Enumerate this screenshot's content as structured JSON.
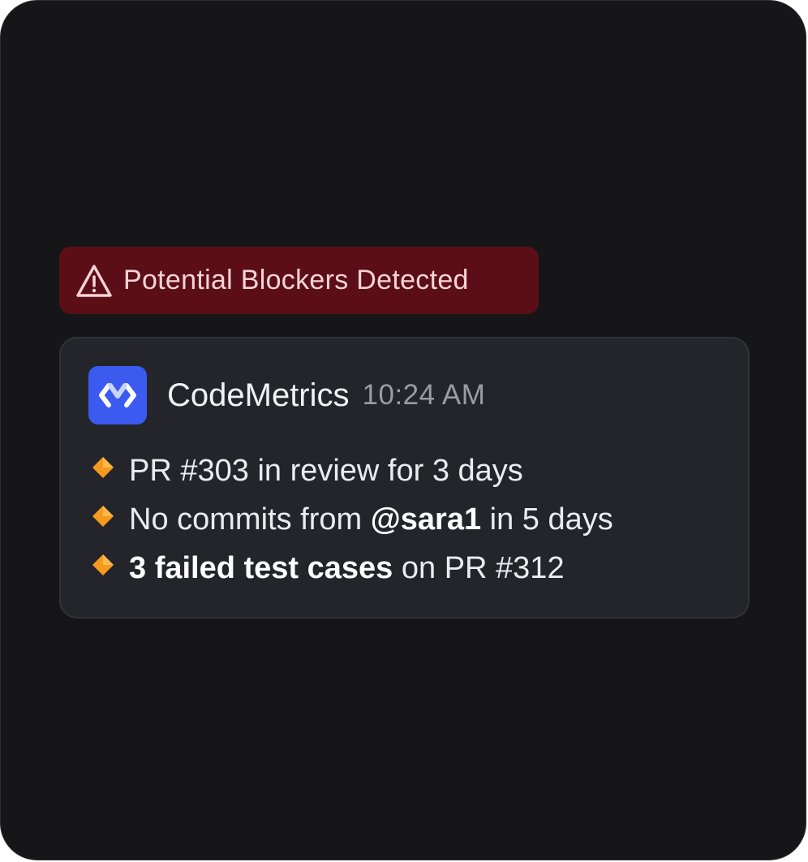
{
  "alert": {
    "icon": "warning-triangle-icon",
    "text": "Potential Blockers Detected",
    "background": "#5c0e16",
    "text_color": "#f6d3d6"
  },
  "message": {
    "avatar_icon": "codemetrics-logo-icon",
    "avatar_color": "#3b5bf0",
    "sender": "CodeMetrics",
    "time": "10:24 AM",
    "items": [
      {
        "bullet_icon": "orange-diamond-icon",
        "text": "PR #303 in review for 3 days"
      },
      {
        "bullet_icon": "orange-diamond-icon",
        "before": "No commits from ",
        "bold": "@sara1",
        "after": " in 5 days"
      },
      {
        "bullet_icon": "orange-diamond-icon",
        "bold": "3 failed test cases",
        "after": " on PR #312"
      }
    ]
  },
  "colors": {
    "frame_background": "#161619",
    "card_background": "#24252b",
    "bullet": "#f59a1e"
  }
}
